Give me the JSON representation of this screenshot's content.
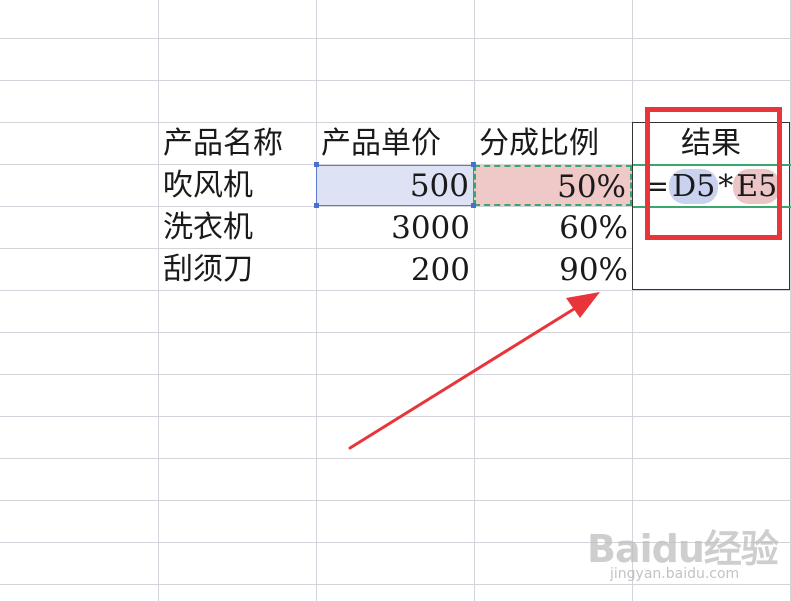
{
  "sheet": {
    "headers": [
      "产品名称",
      "产品单价",
      "分成比例",
      "结果"
    ],
    "rows": [
      {
        "name": "吹风机",
        "price": "500",
        "ratio": "50%"
      },
      {
        "name": "洗衣机",
        "price": "3000",
        "ratio": "60%"
      },
      {
        "name": "刮须刀",
        "price": "200",
        "ratio": "90%"
      }
    ],
    "formula": {
      "prefix": "=",
      "ref1": "D5",
      "op": "*",
      "ref2": "E5"
    }
  },
  "colors": {
    "annotation_red": "#e8353a",
    "ref_blue_bg": "#c9d3f0",
    "ref_red_bg": "#ecc6c6",
    "selection_green": "#3aa76d"
  },
  "watermark": {
    "brand": "Baidu经验",
    "url": "jingyan.baidu.com"
  }
}
